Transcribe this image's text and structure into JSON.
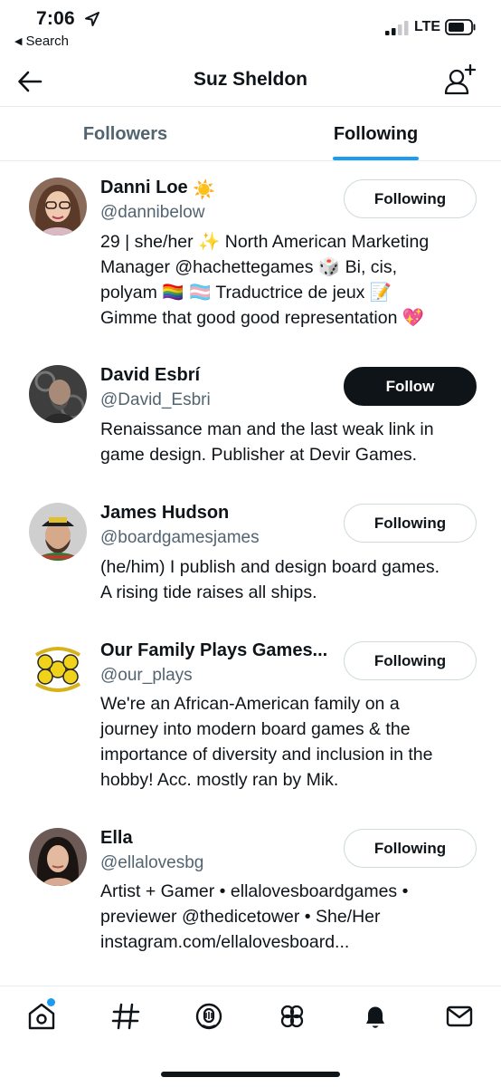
{
  "status_bar": {
    "time": "7:06",
    "back_label": "Search",
    "network": "LTE"
  },
  "header": {
    "title": "Suz Sheldon"
  },
  "tabs": [
    {
      "label": "Followers",
      "selected": false
    },
    {
      "label": "Following",
      "selected": true
    }
  ],
  "accent_color": "#1d9bf0",
  "users": [
    {
      "name": "Danni Loe",
      "name_emoji": "☀️",
      "handle": "@dannibelow",
      "button": "Following",
      "bio_lines": [
        "29 | she/her ✨ North American Marketing",
        "Manager @hachettegames 🎲 Bi, cis,",
        "polyam 🏳️‍🌈 🏳️‍⚧️ Traductrice de jeux 📝",
        "Gimme that good good representation 💖"
      ]
    },
    {
      "name": "David Esbrí",
      "name_emoji": "",
      "handle": "@David_Esbri",
      "button": "Follow",
      "bio_lines": [
        "Renaissance man and the last weak link in",
        "game design. Publisher at Devir Games."
      ]
    },
    {
      "name": "James Hudson",
      "name_emoji": "",
      "handle": "@boardgamesjames",
      "button": "Following",
      "bio_lines": [
        "(he/him) I publish and design board games.",
        "A rising tide raises all ships."
      ]
    },
    {
      "name": "Our Family Plays Games...",
      "name_emoji": "",
      "handle": "@our_plays",
      "button": "Following",
      "bio_lines": [
        "We're an African-American family on a",
        "journey into modern board games & the",
        "importance of diversity and inclusion in the",
        "hobby! Acc. mostly ran by Mik."
      ]
    },
    {
      "name": "Ella",
      "name_emoji": "",
      "handle": "@ellalovesbg",
      "button": "Following",
      "bio_lines": [
        "Artist + Gamer • ellalovesboardgames •",
        "previewer @thedicetower • She/Her",
        "instagram.com/ellalovesboard..."
      ]
    }
  ],
  "bottom_nav": [
    {
      "icon": "home-icon",
      "has_notification_dot": true
    },
    {
      "icon": "explore-hashtag-icon"
    },
    {
      "icon": "spaces-icon"
    },
    {
      "icon": "communities-icon"
    },
    {
      "icon": "notifications-bell-icon"
    },
    {
      "icon": "messages-envelope-icon"
    }
  ]
}
